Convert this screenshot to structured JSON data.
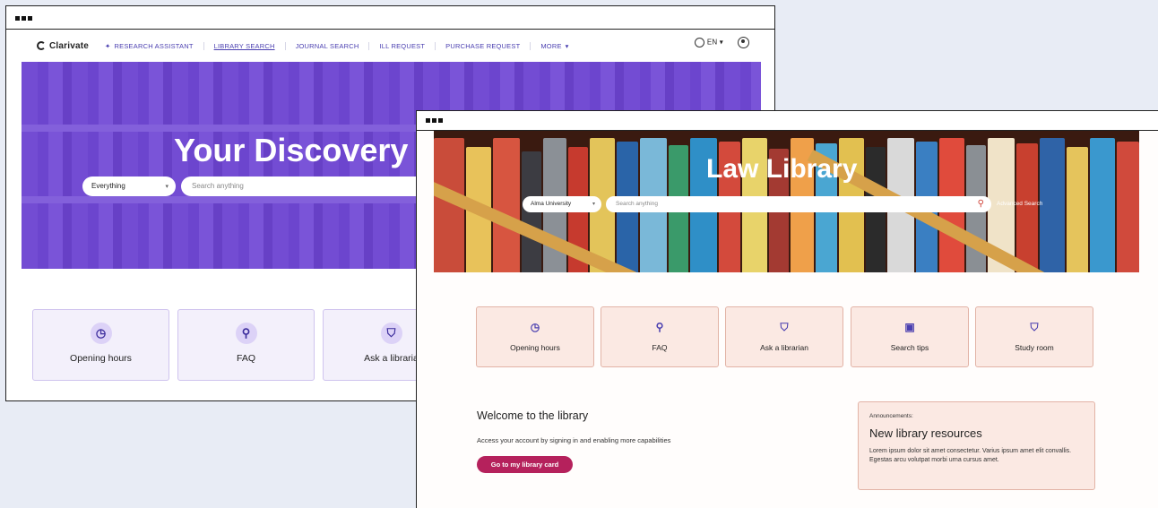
{
  "window1": {
    "brand": "Clarivate",
    "nav": [
      {
        "label": "RESEARCH ASSISTANT"
      },
      {
        "label": "LIBRARY SEARCH"
      },
      {
        "label": "JOURNAL SEARCH"
      },
      {
        "label": "ILL REQUEST"
      },
      {
        "label": "PURCHASE REQUEST"
      },
      {
        "label": "MORE"
      }
    ],
    "language": "EN",
    "hero_title": "Your Discovery",
    "scope_select": "Everything",
    "search_placeholder": "Search anything",
    "cards": [
      {
        "label": "Opening hours",
        "icon": "clock-icon"
      },
      {
        "label": "FAQ",
        "icon": "search-icon"
      },
      {
        "label": "Ask a libraria",
        "icon": "librarian-icon"
      }
    ]
  },
  "window2": {
    "hero_title": "Law Library",
    "scope_select": "Alma University",
    "search_placeholder": "Search anything",
    "advanced_search": "Advanced Search",
    "cards": [
      {
        "label": "Opening hours",
        "icon": "clock-icon"
      },
      {
        "label": "FAQ",
        "icon": "search-icon"
      },
      {
        "label": "Ask a librarian",
        "icon": "librarian-icon"
      },
      {
        "label": "Search tips",
        "icon": "laptop-search-icon"
      },
      {
        "label": "Study room",
        "icon": "study-room-icon"
      }
    ],
    "welcome_title": "Welcome to the library",
    "welcome_text": "Access your account by signing in and enabling more capabilities",
    "library_card_button": "Go to my library card",
    "announcements": {
      "label": "Announcements:",
      "title": "New library resources",
      "body": "Lorem ipsum dolor sit amet consectetur. Varius ipsum amet elit convallis. Egestas arcu volutpat morbi urna cursus amet."
    }
  },
  "colors": {
    "accent_purple": "#4a3fb0",
    "hero_purple": "#6b46c9",
    "primary_button": "#b5215c",
    "card_peach": "#fbe9e3"
  }
}
